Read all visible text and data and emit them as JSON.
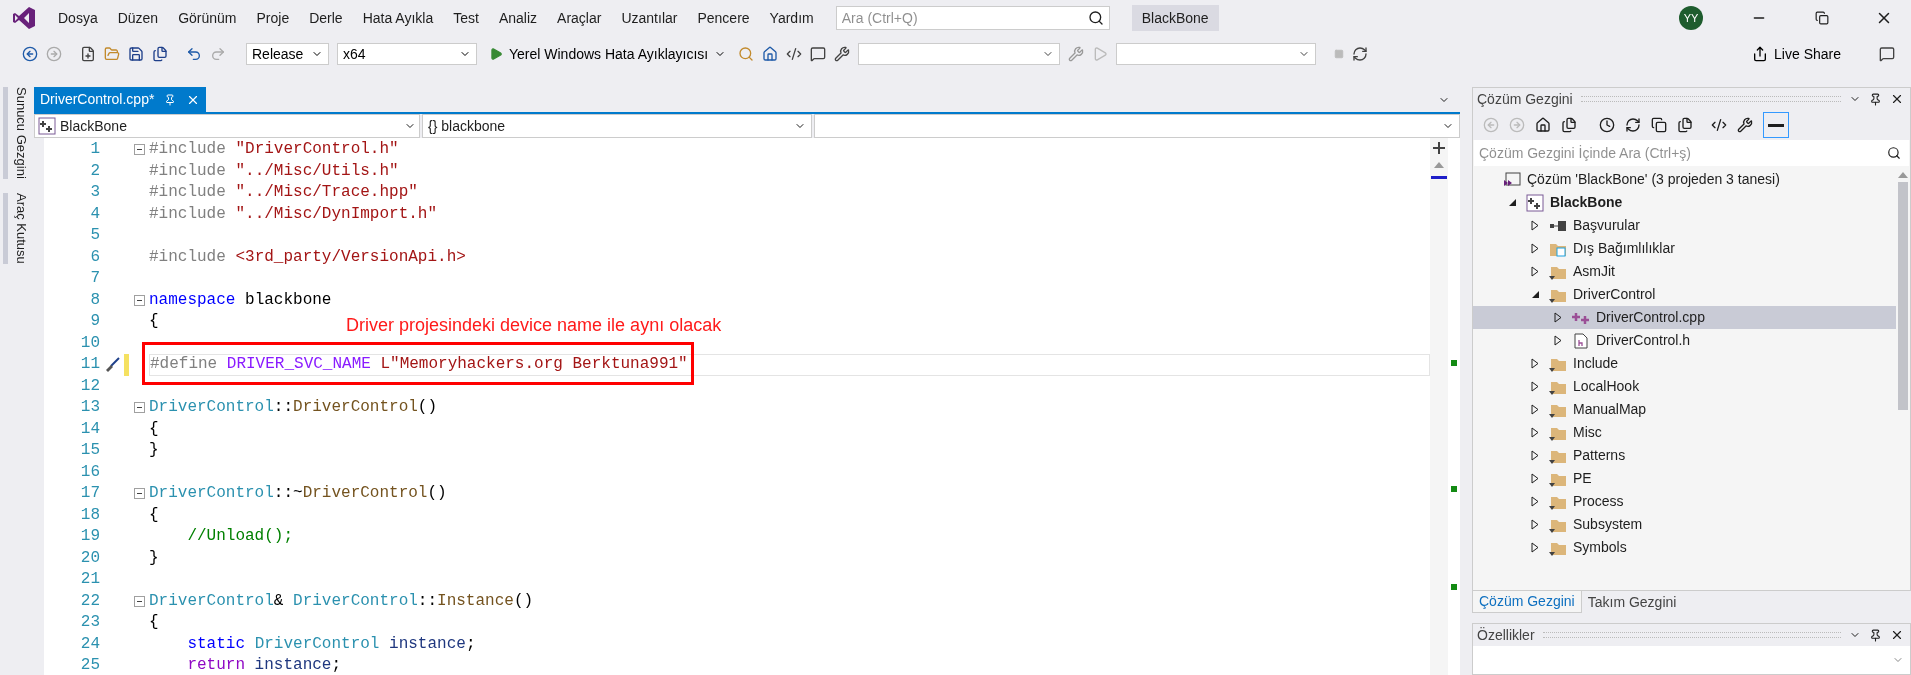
{
  "menu": [
    "Dosya",
    "Düzen",
    "Görünüm",
    "Proje",
    "Derle",
    "Hata Ayıkla",
    "Test",
    "Analiz",
    "Araçlar",
    "Uzantılar",
    "Pencere",
    "Yardım"
  ],
  "search": {
    "placeholder": "Ara (Ctrl+Q)"
  },
  "window": {
    "title": "BlackBone",
    "avatar": "YY"
  },
  "toolbar": {
    "configuration": "Release",
    "platform": "x64",
    "debugger": "Yerel Windows Hata Ayıklayıcısı",
    "live_share": "Live Share"
  },
  "side_tabs": [
    "Sunucu Gezgini",
    "Araç Kutusu"
  ],
  "editor": {
    "tab": {
      "label": "DriverControl.cpp*",
      "selected": true
    },
    "nav": [
      "BlackBone",
      "{} blackbone"
    ],
    "annotation": "Driver projesindeki device name ile aynı olacak",
    "lines": [
      {
        "number": "1",
        "fold": true,
        "current": false,
        "tokens": [
          {
            "kind": "pre",
            "text": "#include "
          },
          {
            "kind": "str",
            "text": "\"DriverControl.h\""
          }
        ]
      },
      {
        "number": "2",
        "fold": false,
        "current": false,
        "tokens": [
          {
            "kind": "pre",
            "text": "#include "
          },
          {
            "kind": "str",
            "text": "\"../Misc/Utils.h\""
          }
        ]
      },
      {
        "number": "3",
        "fold": false,
        "current": false,
        "tokens": [
          {
            "kind": "pre",
            "text": "#include "
          },
          {
            "kind": "str",
            "text": "\"../Misc/Trace.hpp\""
          }
        ]
      },
      {
        "number": "4",
        "fold": false,
        "current": false,
        "tokens": [
          {
            "kind": "pre",
            "text": "#include "
          },
          {
            "kind": "str",
            "text": "\"../Misc/DynImport.h\""
          }
        ]
      },
      {
        "number": "5",
        "fold": false,
        "current": false
      },
      {
        "number": "6",
        "fold": false,
        "current": false,
        "tokens": [
          {
            "kind": "pre",
            "text": "#include "
          },
          {
            "kind": "str",
            "text": "<3rd_party/VersionApi.h>"
          }
        ]
      },
      {
        "number": "7",
        "fold": false,
        "current": false
      },
      {
        "number": "8",
        "fold": true,
        "current": false,
        "tokens": [
          {
            "kind": "kw",
            "text": "namespace"
          },
          {
            "kind": "plain",
            "text": " blackbone"
          }
        ]
      },
      {
        "number": "9",
        "fold": false,
        "current": false,
        "tokens": [
          {
            "kind": "plain",
            "text": "{"
          }
        ]
      },
      {
        "number": "10",
        "fold": false,
        "current": false
      },
      {
        "number": "11",
        "fold": false,
        "current": true,
        "tokens": [
          {
            "kind": "pre",
            "text": "#define "
          },
          {
            "kind": "macro",
            "text": "DRIVER_SVC_NAME"
          },
          {
            "kind": "str",
            "text": " L\"Memoryhackers.org Berktuna991\""
          }
        ]
      },
      {
        "number": "12",
        "fold": false,
        "current": false
      },
      {
        "number": "13",
        "fold": true,
        "current": false,
        "tokens": [
          {
            "kind": "type",
            "text": "DriverControl"
          },
          {
            "kind": "plain",
            "text": "::"
          },
          {
            "kind": "func",
            "text": "DriverControl"
          },
          {
            "kind": "plain",
            "text": "()"
          }
        ]
      },
      {
        "number": "14",
        "fold": false,
        "current": false,
        "tokens": [
          {
            "kind": "plain",
            "text": "{"
          }
        ]
      },
      {
        "number": "15",
        "fold": false,
        "current": false,
        "tokens": [
          {
            "kind": "plain",
            "text": "}"
          }
        ]
      },
      {
        "number": "16",
        "fold": false,
        "current": false
      },
      {
        "number": "17",
        "fold": true,
        "current": false,
        "tokens": [
          {
            "kind": "type",
            "text": "DriverControl"
          },
          {
            "kind": "plain",
            "text": "::~"
          },
          {
            "kind": "func",
            "text": "DriverControl"
          },
          {
            "kind": "plain",
            "text": "()"
          }
        ]
      },
      {
        "number": "18",
        "fold": false,
        "current": false,
        "tokens": [
          {
            "kind": "plain",
            "text": "{"
          }
        ]
      },
      {
        "number": "19",
        "fold": false,
        "current": false,
        "tokens": [
          {
            "kind": "comment",
            "text": "    //Unload();"
          }
        ]
      },
      {
        "number": "20",
        "fold": false,
        "current": false,
        "tokens": [
          {
            "kind": "plain",
            "text": "}"
          }
        ]
      },
      {
        "number": "21",
        "fold": false,
        "current": false
      },
      {
        "number": "22",
        "fold": true,
        "current": false,
        "tokens": [
          {
            "kind": "type",
            "text": "DriverControl"
          },
          {
            "kind": "plain",
            "text": "& "
          },
          {
            "kind": "type",
            "text": "DriverControl"
          },
          {
            "kind": "plain",
            "text": "::"
          },
          {
            "kind": "func",
            "text": "Instance"
          },
          {
            "kind": "plain",
            "text": "()"
          }
        ]
      },
      {
        "number": "23",
        "fold": false,
        "current": false,
        "tokens": [
          {
            "kind": "plain",
            "text": "{"
          }
        ]
      },
      {
        "number": "24",
        "fold": false,
        "current": false,
        "tokens": [
          {
            "kind": "kw",
            "text": "    static "
          },
          {
            "kind": "type",
            "text": "DriverControl"
          },
          {
            "kind": "var",
            "text": " instance"
          },
          {
            "kind": "plain",
            "text": ";"
          }
        ]
      },
      {
        "number": "25",
        "fold": false,
        "current": false,
        "tokens": [
          {
            "kind": "kw2",
            "text": "    return"
          },
          {
            "kind": "var",
            "text": " instance"
          },
          {
            "kind": "plain",
            "text": ";"
          }
        ]
      }
    ]
  },
  "solution_explorer": {
    "title": "Çözüm Gezgini",
    "search": {
      "placeholder": "Çözüm Gezgini İçinde Ara (Ctrl+ş)"
    },
    "tree": [
      {
        "label": "Çözüm 'BlackBone' (3 projeden 3 tanesi)",
        "kind": "solution",
        "selected": false,
        "children": [
          {
            "label": "BlackBone",
            "kind": "project",
            "expanded": true,
            "selected": false,
            "children": [
              {
                "label": "Başvurular",
                "kind": "references",
                "expanded": false,
                "selected": false
              },
              {
                "label": "Dış Bağımlılıklar",
                "kind": "external",
                "expanded": false,
                "selected": false
              },
              {
                "label": "AsmJit",
                "kind": "folder",
                "expanded": false,
                "selected": false
              },
              {
                "label": "DriverControl",
                "kind": "folder",
                "expanded": true,
                "selected": false,
                "children": [
                  {
                    "label": "DriverControl.cpp",
                    "kind": "cpp",
                    "expanded": false,
                    "selected": true
                  },
                  {
                    "label": "DriverControl.h",
                    "kind": "header",
                    "expanded": false,
                    "selected": false
                  }
                ]
              },
              {
                "label": "Include",
                "kind": "folder",
                "expanded": false,
                "selected": false
              },
              {
                "label": "LocalHook",
                "kind": "folder",
                "expanded": false,
                "selected": false
              },
              {
                "label": "ManualMap",
                "kind": "folder",
                "expanded": false,
                "selected": false
              },
              {
                "label": "Misc",
                "kind": "folder",
                "expanded": false,
                "selected": false
              },
              {
                "label": "Patterns",
                "kind": "folder",
                "expanded": false,
                "selected": false
              },
              {
                "label": "PE",
                "kind": "folder",
                "expanded": false,
                "selected": false
              },
              {
                "label": "Process",
                "kind": "folder",
                "expanded": false,
                "selected": false
              },
              {
                "label": "Subsystem",
                "kind": "folder",
                "expanded": false,
                "selected": false
              },
              {
                "label": "Symbols",
                "kind": "folder",
                "expanded": false,
                "selected": false
              }
            ]
          }
        ]
      }
    ],
    "tabs": [
      {
        "label": "Çözüm Gezgini",
        "selected": true
      },
      {
        "label": "Takım Gezgini",
        "selected": false
      }
    ]
  },
  "properties": {
    "title": "Özellikler"
  }
}
